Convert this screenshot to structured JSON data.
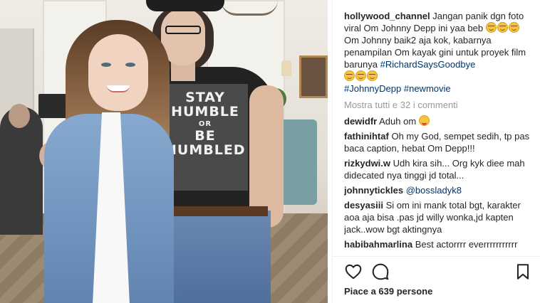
{
  "post": {
    "username": "hollywood_channel",
    "caption_lines": [
      "Jangan panik dgn foto viral Om Johnny Depp ini yaa beb",
      "Om Johnny baik2 aja kok, kabarnya penampilan Om kayak gini untuk proyek film barunya"
    ],
    "hashtags": [
      "#RichardSaysGoodbye",
      "#JohnnyDepp",
      "#newmovie"
    ],
    "shirt_text": [
      "STAY",
      "HUMBLE",
      "OR",
      "BE",
      "HUMBLED"
    ]
  },
  "view_all": "Mostra tutti e 32 i commenti",
  "comments": [
    {
      "user": "dewidfr",
      "text": "Aduh om"
    },
    {
      "user": "fathinihtaf",
      "text": "Oh my God, sempet sedih, tp pas baca caption, hebat Om Depp!!!"
    },
    {
      "user": "rizkydwi.w",
      "text": "Udh kira sih... Org kyk diee mah didecated nya tinggi jd total..."
    },
    {
      "user": "johnnytickles",
      "text": "@bossladyk8"
    },
    {
      "user": "desyasiii",
      "text": "Si om ini mank total bgt, karakter aoa aja bisa .pas jd willy wonka,jd kapten jack..wow bgt aktingnya"
    },
    {
      "user": "habibahmarlina",
      "text": "Best actorrrr everrrrrrrrrrr"
    }
  ],
  "actions": {
    "like_icon": "heart-icon",
    "comment_icon": "comment-icon",
    "save_icon": "bookmark-icon"
  },
  "likes_text": "Piace a 639 persone",
  "colors": {
    "text": "#262626",
    "hashtag": "#003569",
    "muted": "#999999"
  }
}
